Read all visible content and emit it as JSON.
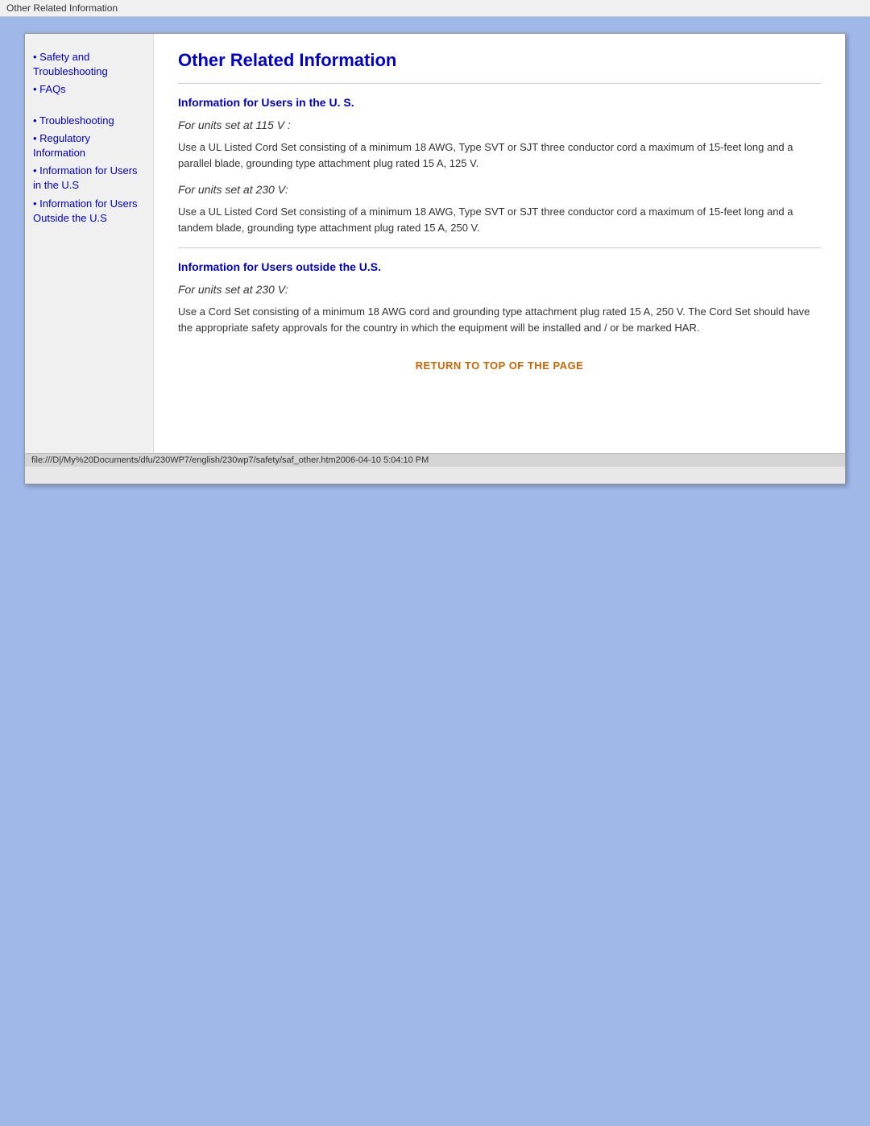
{
  "title_bar": {
    "text": "Other Related Information"
  },
  "sidebar": {
    "items": [
      {
        "label": "Safety and Troubleshooting",
        "indented": false
      },
      {
        "label": "FAQs",
        "indented": false
      },
      {
        "label": "Troubleshooting",
        "indented": false
      },
      {
        "label": "Regulatory Information",
        "indented": false
      },
      {
        "label": "Information for Users in the U.S",
        "indented": false
      },
      {
        "label": "Information for Users Outside the U.S",
        "indented": false
      }
    ]
  },
  "main": {
    "page_title": "Other Related Information",
    "section1": {
      "heading": "Information for Users in the U. S.",
      "block1_italic": "For units set at 115 V :",
      "block1_text": "Use a UL Listed Cord Set consisting of a minimum 18 AWG, Type SVT or SJT three conductor cord a maximum of 15-feet long and a parallel blade, grounding type attachment plug rated 15 A, 125 V.",
      "block2_italic": "For units set at 230 V:",
      "block2_text": "Use a UL Listed Cord Set consisting of a minimum 18 AWG, Type SVT or SJT three conductor cord a maximum of 15-feet long and a tandem blade, grounding type attachment plug rated 15 A, 250 V."
    },
    "section2": {
      "heading": "Information for Users outside the U.S.",
      "block1_italic": "For units set at 230 V:",
      "block1_text": "Use a Cord Set consisting of a minimum 18 AWG cord and grounding type attachment plug rated 15 A, 250 V. The Cord Set should have the appropriate safety approvals for the country in which the equipment will be installed and / or be marked HAR."
    },
    "return_link": "RETURN TO TOP OF THE PAGE"
  },
  "status_bar": {
    "text": "file:///D|/My%20Documents/dfu/230WP7/english/230wp7/safety/saf_other.htm2006-04-10  5:04:10 PM"
  }
}
